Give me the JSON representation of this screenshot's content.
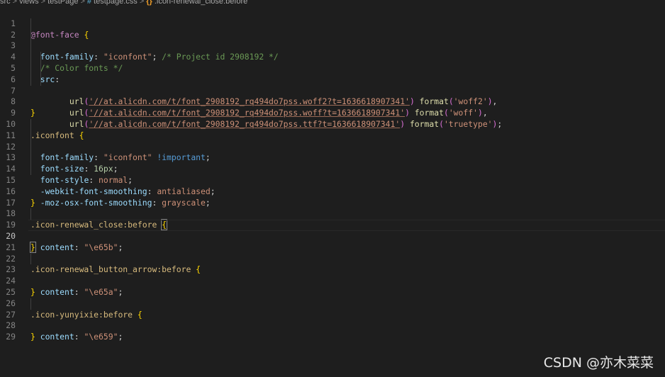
{
  "breadcrumb": {
    "items": [
      "src",
      "views",
      "testPage",
      "testpage.css",
      ".icon-renewal_close:before"
    ],
    "separator": ">",
    "css_icon": "#",
    "symbol_icon": "{}"
  },
  "editor": {
    "line_numbers": [
      "1",
      "2",
      "3",
      "4",
      "5",
      "6",
      "7",
      "8",
      "9",
      "10",
      "11",
      "12",
      "13",
      "14",
      "15",
      "16",
      "17",
      "18",
      "19",
      "20",
      "21",
      "22",
      "23",
      "24",
      "25",
      "26",
      "27",
      "28",
      "29"
    ],
    "current_line": "20",
    "tokens": {
      "at_font_face": "@font-face",
      "brace_open": "{",
      "brace_close": "}",
      "font_family": "font-family",
      "colon": ":",
      "semicolon": ";",
      "comma": ",",
      "iconfont_str": "\"iconfont\"",
      "comment_project": "/* Project id 2908192 */",
      "comment_color": "/* Color fonts */",
      "src": "src",
      "url_fn": "url",
      "paren_open": "(",
      "paren_close": ")",
      "url_woff2": "'//at.alicdn.com/t/font_2908192_rq494do7pss.woff2?t=1636618907341'",
      "url_woff": "'//at.alicdn.com/t/font_2908192_rq494do7pss.woff?t=1636618907341'",
      "url_ttf": "'//at.alicdn.com/t/font_2908192_rq494do7pss.ttf?t=1636618907341'",
      "format_fn": "format",
      "fmt_woff2": "'woff2'",
      "fmt_woff": "'woff'",
      "fmt_truetype": "'truetype'",
      "sel_iconfont": ".iconfont",
      "important": "!important",
      "font_size": "font-size",
      "size_val": "16px",
      "font_style": "font-style",
      "normal": "normal",
      "webkit_smoothing": "-webkit-font-smoothing",
      "antialiased": "antialiased",
      "moz_smoothing": "-moz-osx-font-smoothing",
      "grayscale": "grayscale",
      "sel_close": ".icon-renewal_close:before",
      "content": "content",
      "val_e65b": "\"\\e65b\"",
      "sel_arrow": ".icon-renewal_button_arrow:before",
      "val_e65a": "\"\\e65a\"",
      "sel_yunyixie": ".icon-yunyixie:before",
      "val_e659": "\"\\e659\""
    }
  },
  "watermark": "CSDN @亦木菜菜"
}
